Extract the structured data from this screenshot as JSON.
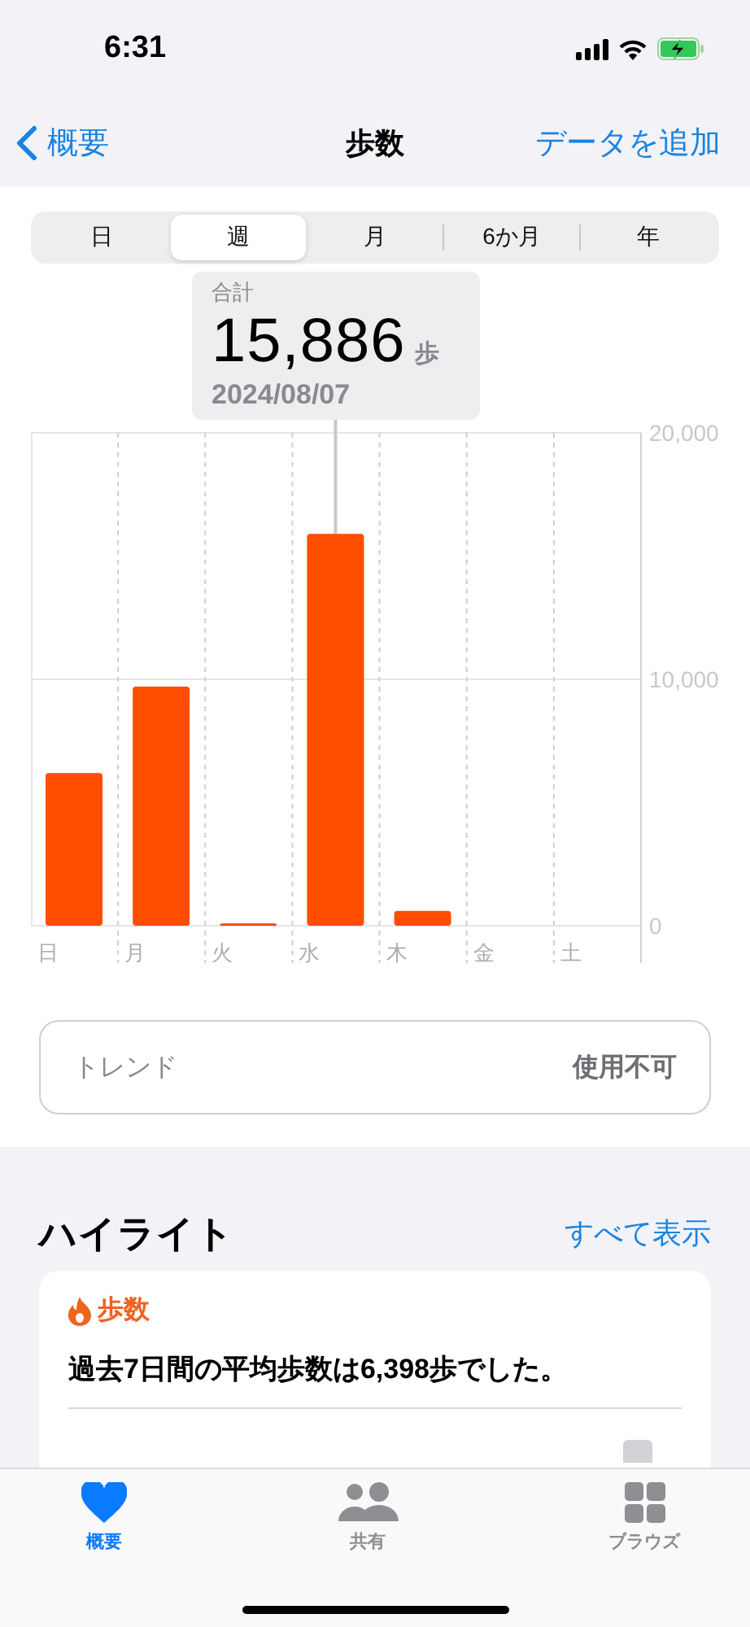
{
  "status_bar": {
    "time": "6:31"
  },
  "nav": {
    "back": "概要",
    "title": "歩数",
    "action": "データを追加"
  },
  "segments": [
    {
      "label": "日",
      "selected": false
    },
    {
      "label": "週",
      "selected": true
    },
    {
      "label": "月",
      "selected": false
    },
    {
      "label": "6か月",
      "selected": false
    },
    {
      "label": "年",
      "selected": false
    }
  ],
  "summary": {
    "caption": "合計",
    "value": "15,886",
    "unit": "歩",
    "date": "2024/08/07"
  },
  "chart_data": {
    "type": "bar",
    "categories": [
      "日",
      "月",
      "火",
      "水",
      "木",
      "金",
      "土"
    ],
    "values": [
      6200,
      9700,
      40,
      15900,
      600,
      null,
      null
    ],
    "ylim": [
      0,
      20000
    ],
    "yticks": [
      {
        "value": 0,
        "label": "0"
      },
      {
        "value": 10000,
        "label": "10,000"
      },
      {
        "value": 20000,
        "label": "20,000"
      }
    ],
    "color": "#ff4e00"
  },
  "trend": {
    "label": "トレンド",
    "value": "使用不可"
  },
  "highlights": {
    "title": "ハイライト",
    "link": "すべて表示",
    "card": {
      "category": "歩数",
      "text": "過去7日間の平均歩数は6,398歩でした。"
    }
  },
  "tab_bar": [
    {
      "kind": "heart",
      "label": "概要",
      "selected": true
    },
    {
      "kind": "people",
      "label": "共有",
      "selected": false
    },
    {
      "kind": "grid",
      "label": "ブラウズ",
      "selected": false
    }
  ]
}
